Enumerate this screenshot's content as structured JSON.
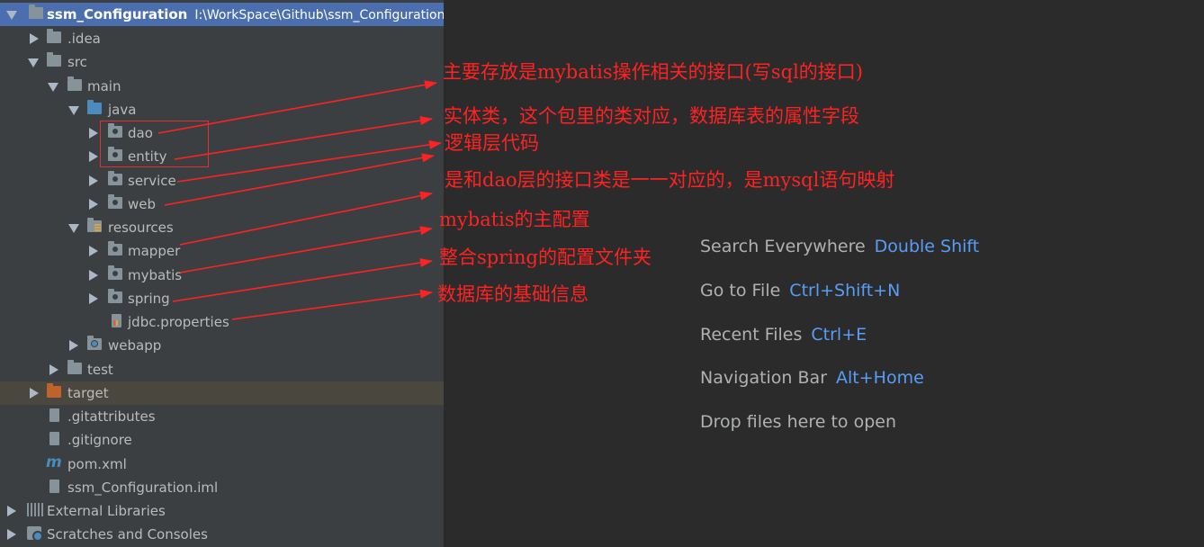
{
  "tree": {
    "project_name": "ssm_Configuration",
    "project_path": "I:\\WorkSpace\\Github\\ssm_Configuration",
    "items": [
      {
        "label": ".idea"
      },
      {
        "label": "src"
      },
      {
        "label": "main"
      },
      {
        "label": "java"
      },
      {
        "label": "dao"
      },
      {
        "label": "entity"
      },
      {
        "label": "service"
      },
      {
        "label": "web"
      },
      {
        "label": "resources"
      },
      {
        "label": "mapper"
      },
      {
        "label": "mybatis"
      },
      {
        "label": "spring"
      },
      {
        "label": "jdbc.properties"
      },
      {
        "label": "webapp"
      },
      {
        "label": "test"
      },
      {
        "label": "target"
      },
      {
        "label": ".gitattributes"
      },
      {
        "label": ".gitignore"
      },
      {
        "label": "pom.xml"
      },
      {
        "label": "ssm_Configuration.iml"
      },
      {
        "label": "External Libraries"
      },
      {
        "label": "Scratches and Consoles"
      }
    ]
  },
  "annotations": [
    "主要存放是mybatis操作相关的接口(写sql的接口)",
    "实体类，这个包里的类对应，数据库表的属性字段",
    "逻辑层代码",
    "是和dao层的接口类是一一对应的，是mysql语句映射",
    "mybatis的主配置",
    "整合spring的配置文件夹",
    "数据库的基础信息"
  ],
  "hints": [
    {
      "label": "Search Everywhere",
      "shortcut": "Double Shift"
    },
    {
      "label": "Go to File",
      "shortcut": "Ctrl+Shift+N"
    },
    {
      "label": "Recent Files",
      "shortcut": "Ctrl+E"
    },
    {
      "label": "Navigation Bar",
      "shortcut": "Alt+Home"
    },
    {
      "label": "Drop files here to open",
      "shortcut": ""
    }
  ],
  "colors": {
    "panel_bg": "#3c3f41",
    "editor_bg": "#2b2b2b",
    "selection": "#4b6eaf",
    "annotation_red": "#ff2222",
    "shortcut_blue": "#589df6"
  }
}
